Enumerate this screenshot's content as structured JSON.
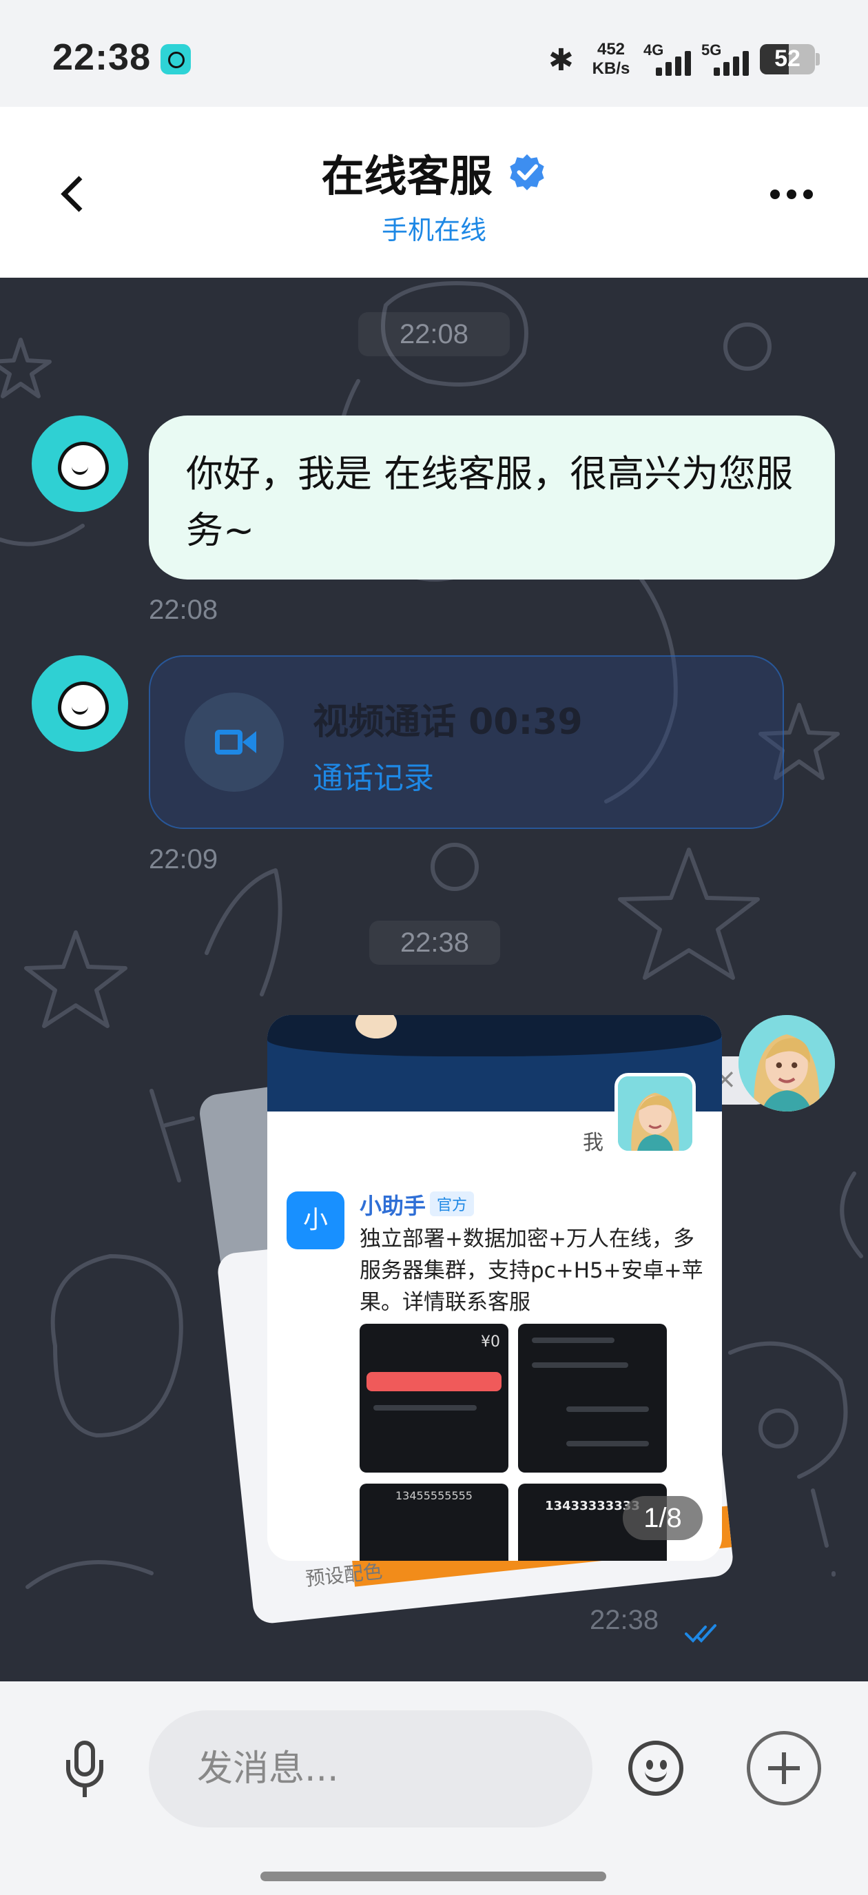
{
  "status_bar": {
    "time": "22:38",
    "net_speed_value": "452",
    "net_speed_unit": "KB/s",
    "signal1_label": "4G",
    "signal2_label": "5G",
    "battery_level": "52",
    "bluetooth_glyph": "✱"
  },
  "header": {
    "title": "在线客服",
    "subtitle": "手机在线"
  },
  "chat": {
    "messages": [
      {
        "time_pill": "22:08",
        "text": "你好，我是 在线客服，很高兴为您服务~",
        "time": "22:08"
      },
      {
        "call_title": "视频通话 00:39",
        "call_link": "通话记录",
        "time": "22:09"
      },
      {
        "time_pill": "22:38",
        "media_counter": "1/8",
        "time": "22:38",
        "preview": {
          "me_label": "我",
          "post_icon_letter": "小",
          "post_name": "小助手",
          "post_badge": "官方",
          "post_text": "独立部署+数据加密+万人在线，多服务器集群，支持pc+H5+安卓+苹果。详情联系客服",
          "back_card_label": "预设配色",
          "thumb_balance": "¥0",
          "thumb_phone_1": "13455555555",
          "thumb_phone_2": "13433333333"
        }
      }
    ]
  },
  "input_bar": {
    "placeholder": "发消息..."
  },
  "colors": {
    "accent": "#1e88e5",
    "bubble": "#e9faf3",
    "avatar": "#2fd0d3"
  }
}
